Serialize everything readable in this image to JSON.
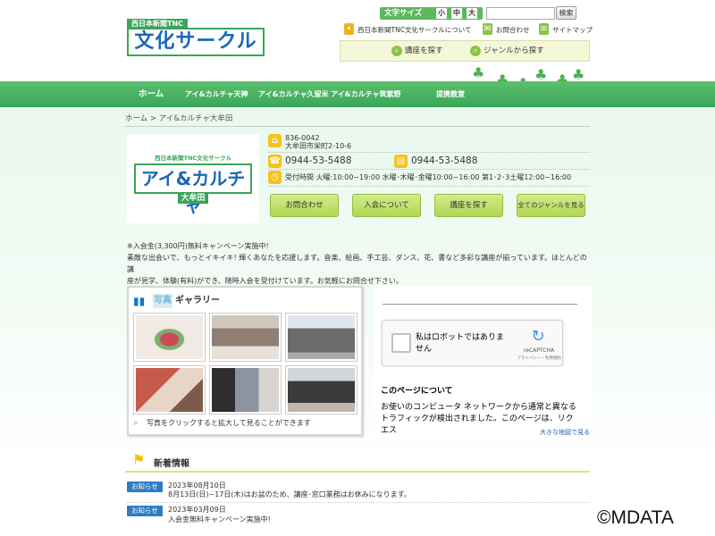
{
  "header": {
    "logo_top": "西日本新聞TNC",
    "logo_main": "文化サークル",
    "font_size_label": "文字サイズ",
    "font_sizes": [
      "小",
      "中",
      "大"
    ],
    "search_button": "検索",
    "links": [
      "西日本新聞TNC文化サークルについて",
      "お問合わせ",
      "サイトマップ"
    ],
    "genre_search": "講座を探す",
    "genre_from": "ジャンルから探す"
  },
  "nav": [
    "ホーム",
    "アイ&カルチャ天神",
    "アイ&カルチャ久留米",
    "アイ&カルチャ筑紫野",
    "提携教室"
  ],
  "breadcrumb": {
    "home": "ホーム",
    "sep": ">",
    "current": "アイ&カルチャ大牟田"
  },
  "store": {
    "logo_top": "西日本新聞TNC文化サークル",
    "logo_main": "アイ&カルチャ",
    "logo_sub": "大牟田",
    "postal": "836-0042",
    "address": "大牟田市栄町2-10-6",
    "tel": "0944-53-5488",
    "fax": "0944-53-5488",
    "hours": "受付時間 火曜:10:00~19:00 水曜･木曜･金曜10:00~16:00 第1･2･3土曜12:00~16:00",
    "buttons": [
      "お問合わせ",
      "入会について",
      "講座を探す",
      "全てのジャンルを見る"
    ]
  },
  "notice": {
    "line1": "※入会金(3,300円)無料キャンペーン実施中!",
    "line2": "素敵な出会いで、もっとイキイキ! 輝くあなたを応援します。音楽、絵画、手工芸、ダンス、花、書など多彩な講座が揃っています。ほとんどの講",
    "line3": "座が見学、体験(有料)ができ、随時入会を受付けています。お気軽にお問合せ下さい。"
  },
  "gallery": {
    "tag": "写真",
    "title": "ギャラリー",
    "note": "写真をクリックすると拡大して見ることができます"
  },
  "captcha": {
    "label": "私はロボットではありません",
    "brand": "reCAPTCHA",
    "sub": "プライバシー・利用規約"
  },
  "map": {
    "heading": "このページについて",
    "body": "お使いのコンピュータ ネットワークから通常と異なるトラフィックが検出されました。このページは、リクエス",
    "link": "大きな地図で見る"
  },
  "news": {
    "title": "新着情報",
    "items": [
      {
        "badge": "お知らせ",
        "date": "2023年08月10日",
        "text": "8月13日(日)~17日(木)はお盆のため、講座･窓口業務はお休みになります。"
      },
      {
        "badge": "お知らせ",
        "date": "2023年03月09日",
        "text": "入会金無料キャンペーン実施中!"
      }
    ]
  },
  "watermark": "©MDATA",
  "colors": {
    "brand_green": "#3aa55a",
    "brand_blue": "#1c68b6",
    "badge_blue": "#2f7cc1"
  }
}
